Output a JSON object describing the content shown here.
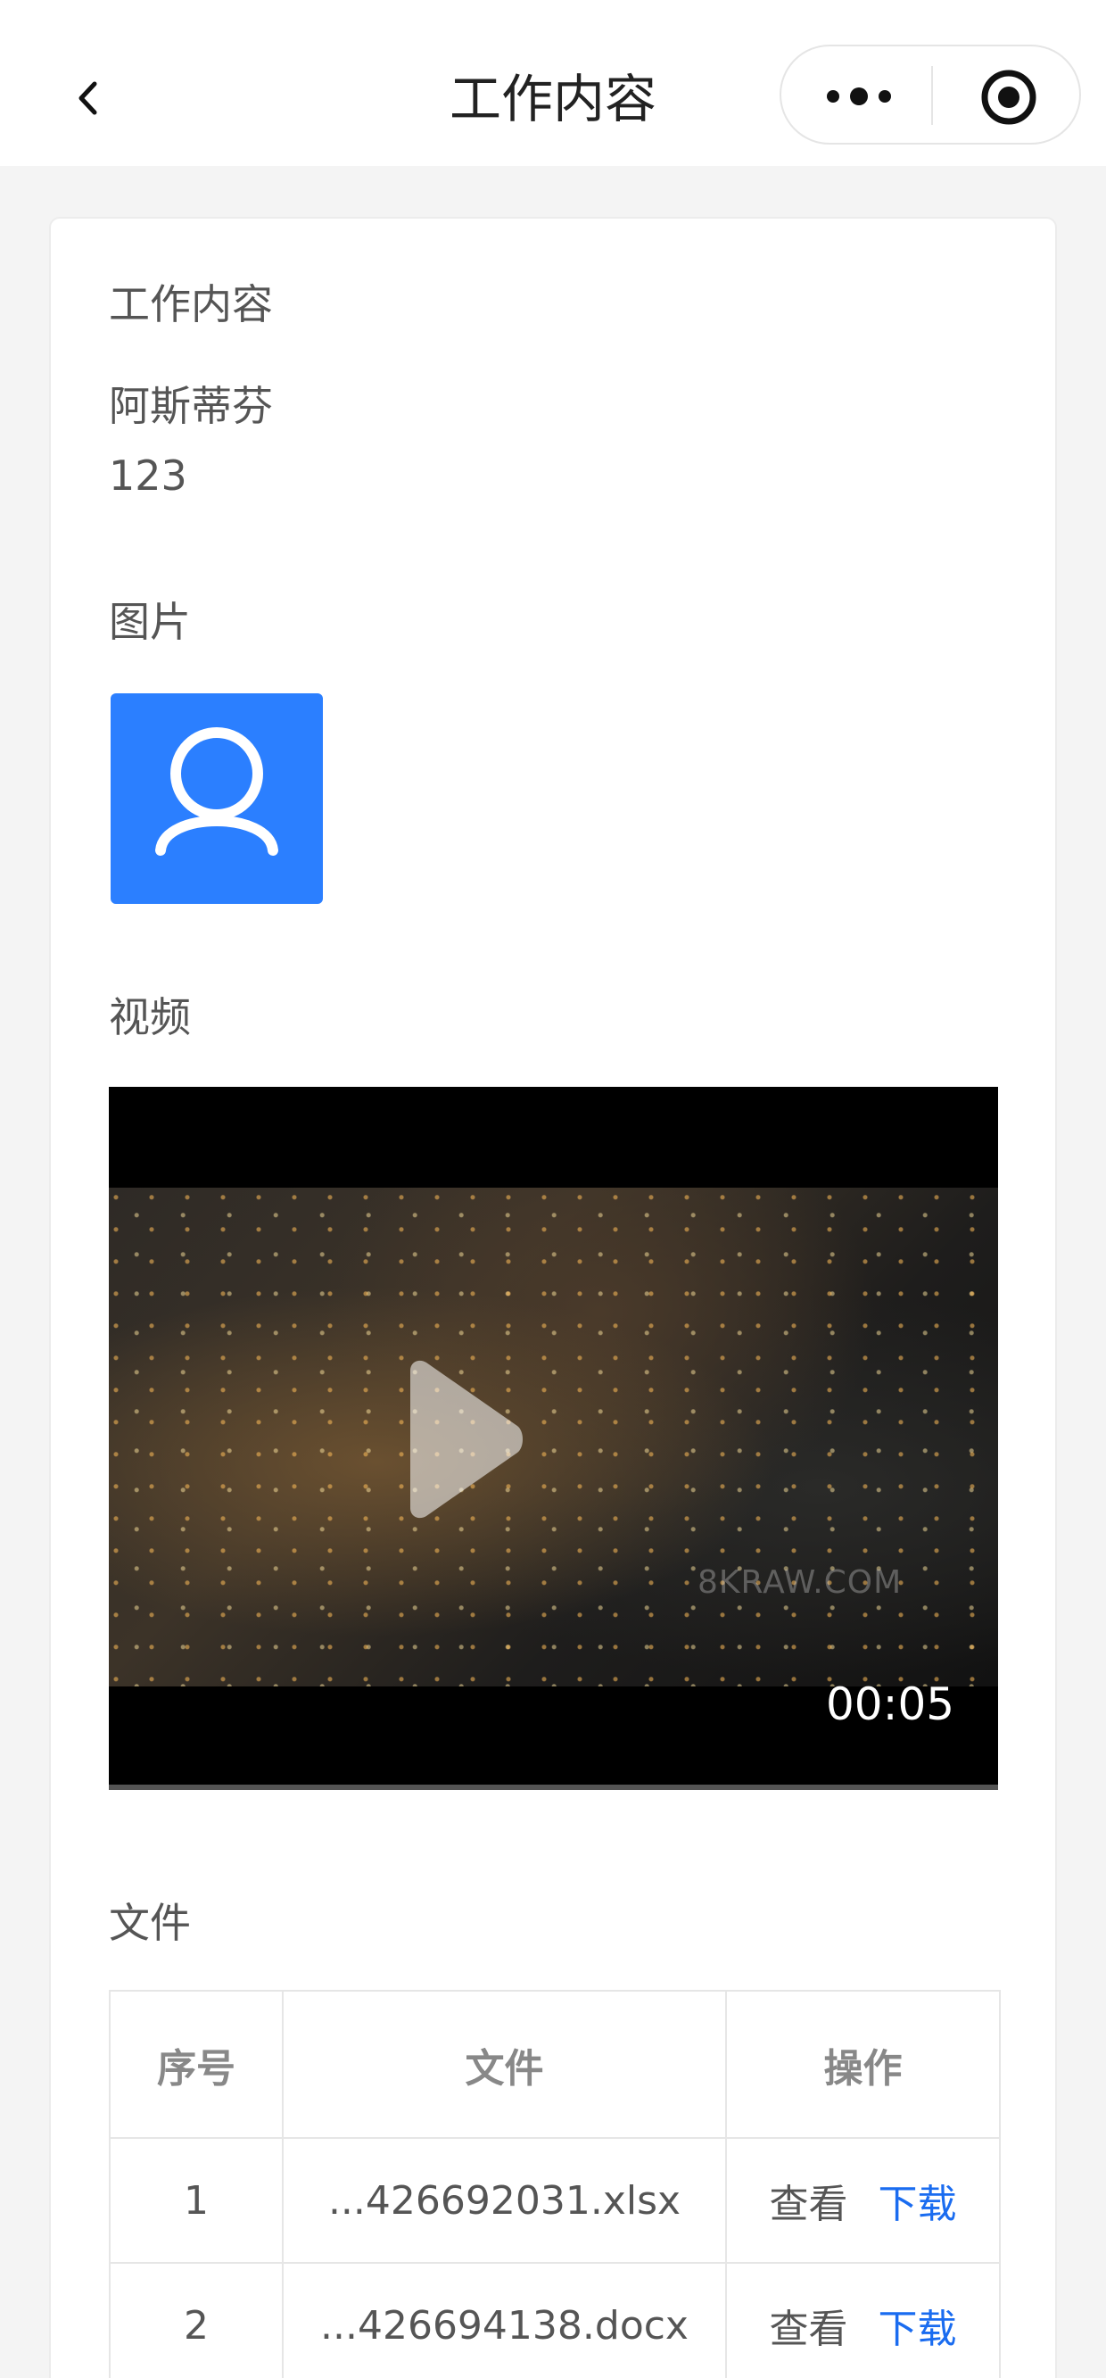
{
  "navbar": {
    "title": "工作内容"
  },
  "content": {
    "section_work": {
      "label": "工作内容",
      "line1": "阿斯蒂芬",
      "line2": "123"
    },
    "section_image": {
      "label": "图片"
    },
    "section_video": {
      "label": "视频",
      "watermark": "8KRAW.COM",
      "duration": "00:05"
    },
    "section_file": {
      "label": "文件",
      "headers": [
        "序号",
        "文件",
        "操作"
      ],
      "rows": [
        {
          "no": "1",
          "file": "...426692031.xlsx",
          "view": "查看",
          "download": "下载"
        },
        {
          "no": "2",
          "file": "...426694138.docx",
          "view": "查看",
          "download": "下载"
        }
      ]
    }
  },
  "colors": {
    "accent": "#2b7fff",
    "link": "#1a6cf0"
  }
}
